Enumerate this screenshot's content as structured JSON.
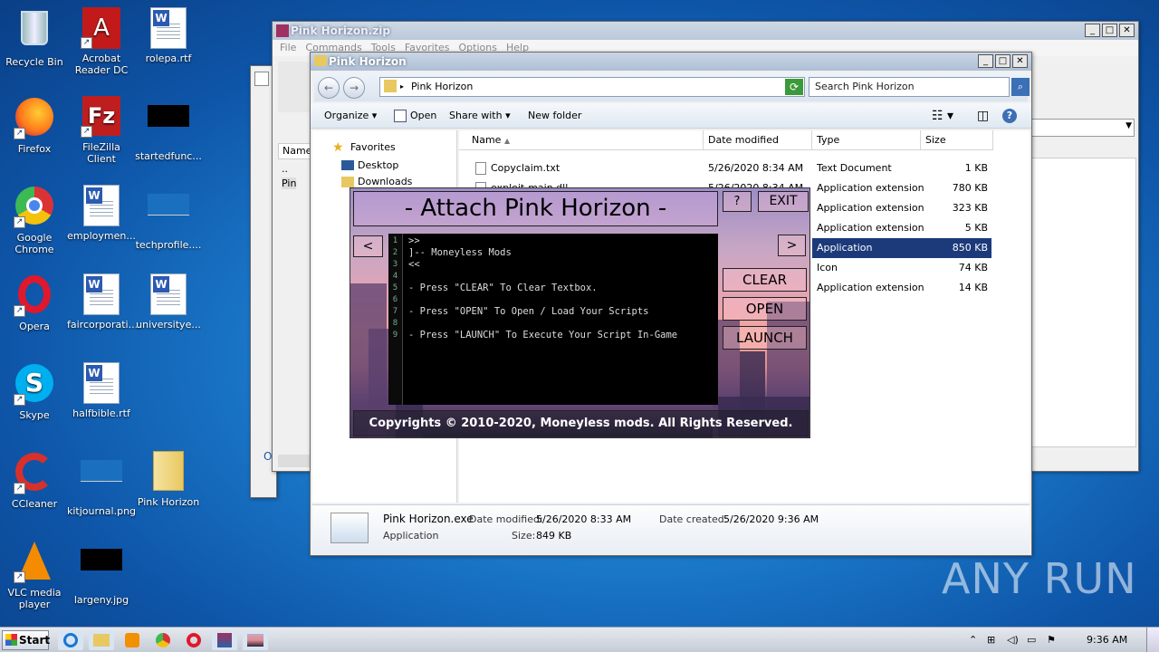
{
  "desktop": {
    "icons": [
      {
        "label": "Recycle Bin"
      },
      {
        "label": "Acrobat Reader DC"
      },
      {
        "label": "rolepa.rtf"
      },
      {
        "label": "Firefox"
      },
      {
        "label": "FileZilla Client"
      },
      {
        "label": "startedfunc..."
      },
      {
        "label": "Google Chrome"
      },
      {
        "label": "employmen..."
      },
      {
        "label": "techprofile...."
      },
      {
        "label": "Opera"
      },
      {
        "label": "faircorporati..."
      },
      {
        "label": "universitye..."
      },
      {
        "label": "Skype"
      },
      {
        "label": "halfbible.rtf"
      },
      {
        "label": "CCleaner"
      },
      {
        "label": "kitjournal.png"
      },
      {
        "label": "Pink Horizon"
      },
      {
        "label": "VLC media player"
      },
      {
        "label": "largeny.jpg"
      }
    ]
  },
  "winrar": {
    "title": "Pink Horizon.zip",
    "menu": [
      "File",
      "Commands",
      "Tools",
      "Favorites",
      "Options",
      "Help"
    ],
    "col_name": "Name",
    "rows": [
      "..",
      "Pin"
    ],
    "options_link": "Options"
  },
  "explorer": {
    "title": "Pink Horizon",
    "address": "Pink Horizon",
    "search_placeholder": "Search Pink Horizon",
    "toolbar": {
      "organize": "Organize",
      "open": "Open",
      "share": "Share with",
      "newfolder": "New folder"
    },
    "nav": {
      "favorites": "Favorites",
      "desktop": "Desktop",
      "downloads": "Downloads"
    },
    "columns": {
      "name": "Name",
      "modified": "Date modified",
      "type": "Type",
      "size": "Size"
    },
    "files": [
      {
        "name": "Copyclaim.txt",
        "modified": "5/26/2020 8:34 AM",
        "type": "Text Document",
        "size": "1 KB"
      },
      {
        "name": "exploit-main.dll",
        "modified": "5/26/2020 8:34 AM",
        "type": "Application extension",
        "size": "780 KB"
      },
      {
        "name": "",
        "modified": "",
        "type": "Application extension",
        "size": "323 KB"
      },
      {
        "name": "",
        "modified": "",
        "type": "Application extension",
        "size": "5 KB"
      },
      {
        "name": "",
        "modified": "",
        "type": "Application",
        "size": "850 KB"
      },
      {
        "name": "",
        "modified": "",
        "type": "Icon",
        "size": "74 KB"
      },
      {
        "name": "",
        "modified": "",
        "type": "Application extension",
        "size": "14 KB"
      }
    ],
    "details": {
      "filename": "Pink Horizon.exe",
      "modified_label": "Date modified:",
      "modified": "5/26/2020 8:33 AM",
      "created_label": "Date created:",
      "created": "5/26/2020 9:36 AM",
      "type": "Application",
      "size_label": "Size:",
      "size": "849 KB"
    }
  },
  "pinkapp": {
    "title": "- Attach Pink Horizon -",
    "help": "?",
    "exit": "EXIT",
    "prev": "<",
    "next": ">",
    "clear": "CLEAR",
    "open": "OPEN",
    "launch": "LAUNCH",
    "code": ">>\n]-- Moneyless Mods\n<<\n\n- Press \"CLEAR\" To Clear Textbox.\n\n- Press \"OPEN\" To Open / Load Your Scripts\n\n- Press \"LAUNCH\" To Execute Your Script In-Game",
    "line_numbers": "1\n2\n3\n4\n5\n6\n7\n8\n9",
    "footer": "Copyrights © 2010-2020, Moneyless mods. All Rights Reserved."
  },
  "taskbar": {
    "start": "Start",
    "clock": "9:36 AM"
  },
  "watermark": "ANY RUN",
  "colors": {
    "selection": "#1c3a7a",
    "pink_sky": "#e6a3b2"
  }
}
